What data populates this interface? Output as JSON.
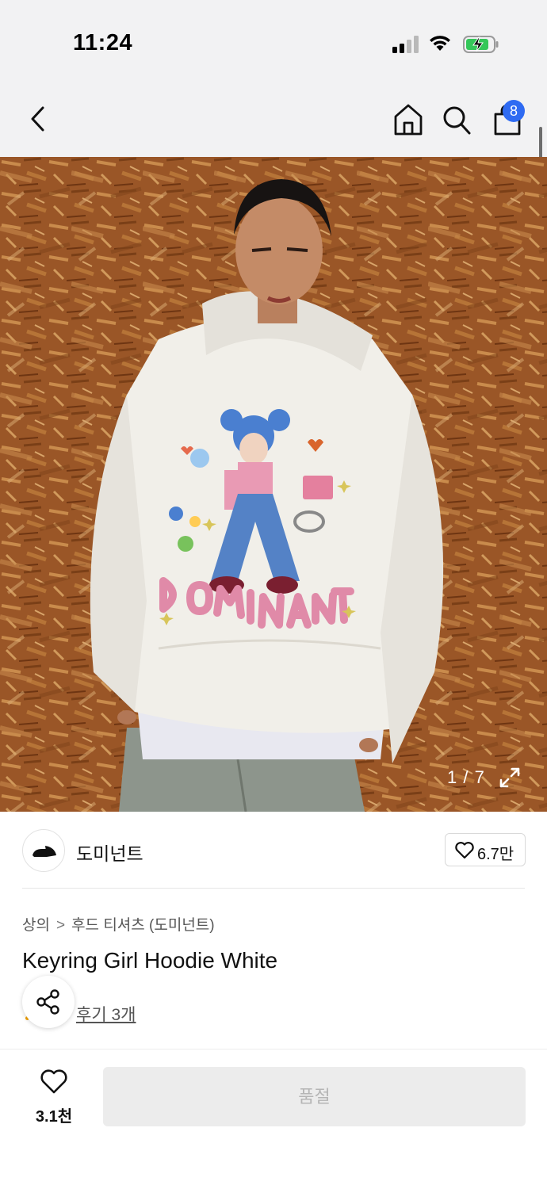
{
  "status_bar": {
    "time": "11:24"
  },
  "nav": {
    "cart_count": "8"
  },
  "hero": {
    "image_counter": "1 / 7",
    "print_text": "DOMINANT"
  },
  "brand": {
    "name": "도미넌트",
    "likes": "6.7만"
  },
  "product": {
    "breadcrumb": [
      "상의",
      "후드 티셔츠 (도미넌트)"
    ],
    "breadcrumb_separator": ">",
    "title": "Keyring Girl Hoodie White",
    "reviews": "후기 3개"
  },
  "bottom_bar": {
    "wish_count": "3.1천",
    "buy_label": "품절"
  },
  "icons": {
    "back": "chevron-left-icon",
    "home": "home-icon",
    "search": "search-icon",
    "cart": "shopping-bag-icon",
    "expand": "expand-icon",
    "heart": "heart-icon",
    "share": "share-icon"
  },
  "colors": {
    "badge": "#2f6bf2",
    "battery": "#34c759",
    "soldout_bg": "#ececec"
  }
}
